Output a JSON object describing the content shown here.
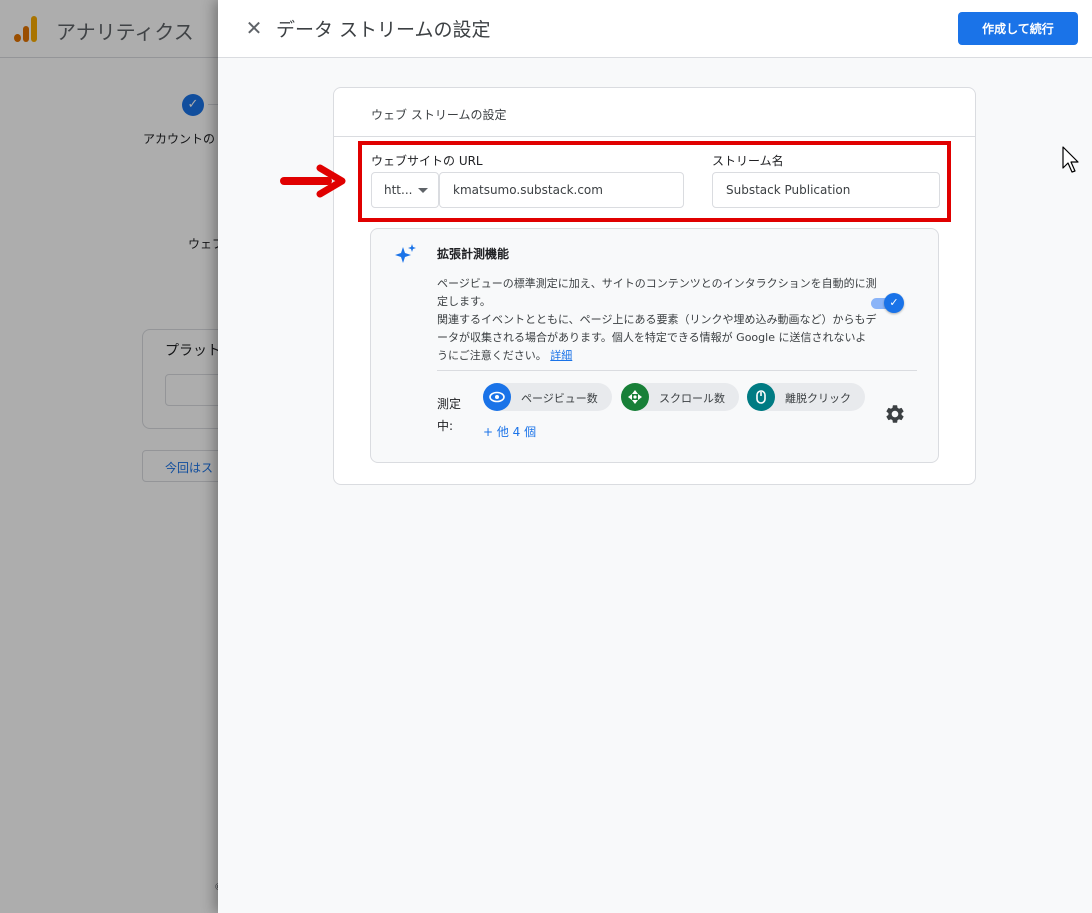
{
  "background": {
    "app_title": "アナリティクス",
    "step_label": "アカウントの",
    "web_label": "ウェブ",
    "platform_label": "プラット",
    "skip_label": "今回はス",
    "footer_char": "©"
  },
  "drawer": {
    "title": "データ ストリームの設定",
    "close_icon": "close-icon",
    "create_button_label": "作成して続行"
  },
  "card": {
    "title": "ウェブ ストリームの設定",
    "url_label": "ウェブサイトの URL",
    "protocol_value": "htt...",
    "url_value": "kmatsumo.substack.com",
    "stream_name_label": "ストリーム名",
    "stream_name_value": "Substack Publication"
  },
  "enhanced": {
    "title": "拡張計測機能",
    "desc_1": "ページビューの標準測定に加え、サイトのコンテンツとのインタラクションを自動的に測定します。",
    "desc_2": "関連するイベントとともに、ページ上にある要素（リンクや埋め込み動画など）からもデータが収集される場合があります。個人を特定できる情報が Google に送信されないようにご注意ください。",
    "detail_link": "詳細",
    "toggle_on": true,
    "measuring_label": "測定中:",
    "chips": [
      {
        "label": "ページビュー数",
        "icon": "eye-icon",
        "color": "#1a73e8"
      },
      {
        "label": "スクロール数",
        "icon": "scroll-icon",
        "color": "#188038"
      },
      {
        "label": "離脱クリック",
        "icon": "mouse-icon",
        "color": "#007b83"
      }
    ],
    "more_link": "+ 他 4 個"
  },
  "annotation": {
    "highlight_color": "#e00000"
  }
}
